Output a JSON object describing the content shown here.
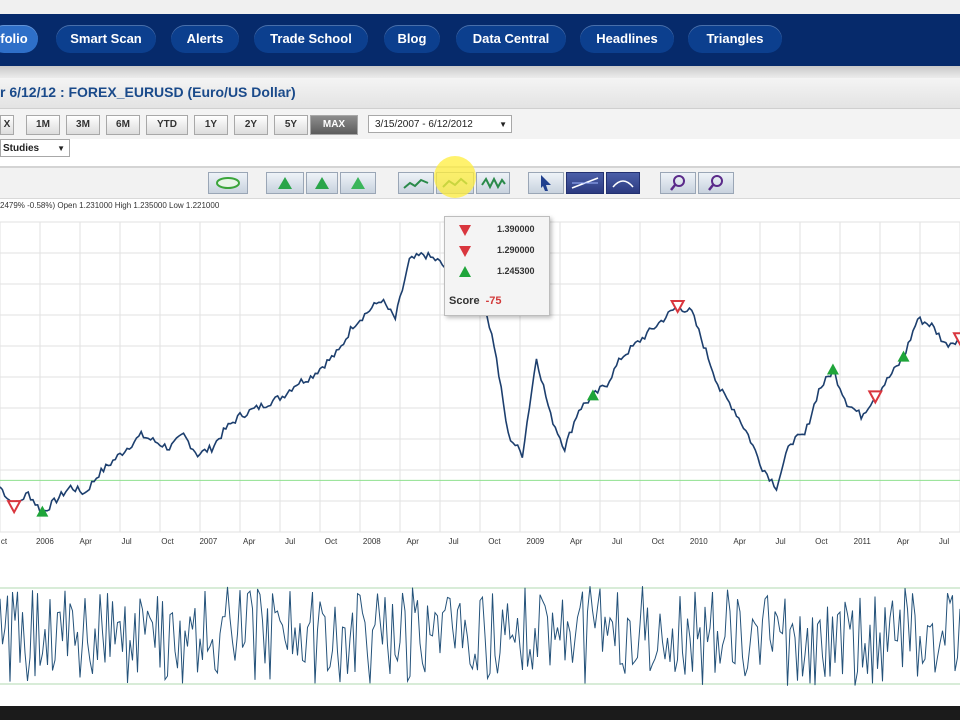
{
  "nav": {
    "items": [
      "folio",
      "Smart Scan",
      "Alerts",
      "Trade School",
      "Blog",
      "Data Central",
      "Headlines",
      "Triangles"
    ]
  },
  "title": "r 6/12/12 : FOREX_EURUSD (Euro/US Dollar)",
  "ranges": [
    "X",
    "1M",
    "3M",
    "6M",
    "YTD",
    "1Y",
    "2Y",
    "5Y",
    "MAX"
  ],
  "selected_range": "MAX",
  "date_range": "3/15/2007 - 6/12/2012",
  "studies_label": "Studies",
  "info_line": "2479% -0.58%) Open 1.231000 High 1.235000 Low 1.221000",
  "popup": {
    "rows": [
      {
        "marker": "sell",
        "value": "1.390000"
      },
      {
        "marker": "sell",
        "value": "1.290000"
      },
      {
        "marker": "buy",
        "value": "1.245300"
      }
    ],
    "score_label": "Score",
    "score_value": "-75"
  },
  "chart_data": {
    "type": "line",
    "x_ticks": [
      "ct",
      "2006",
      "Apr",
      "Jul",
      "Oct",
      "2007",
      "Apr",
      "Jul",
      "Oct",
      "2008",
      "Apr",
      "Jul",
      "Oct",
      "2009",
      "Apr",
      "Jul",
      "Oct",
      "2010",
      "Apr",
      "Jul",
      "Oct",
      "2011",
      "Apr",
      "Jul"
    ],
    "ylim": [
      1.15,
      1.63
    ],
    "reference_line": 1.23,
    "series": [
      {
        "values": [
          1.22,
          1.19,
          1.21,
          1.18,
          1.2,
          1.22,
          1.21,
          1.24,
          1.26,
          1.28,
          1.3,
          1.29,
          1.28,
          1.3,
          1.27,
          1.28,
          1.31,
          1.33,
          1.34,
          1.35,
          1.36,
          1.38,
          1.39,
          1.41,
          1.43,
          1.47,
          1.49,
          1.51,
          1.48,
          1.57,
          1.58,
          1.57,
          1.55,
          1.56,
          1.53,
          1.44,
          1.3,
          1.27,
          1.42,
          1.33,
          1.28,
          1.34,
          1.36,
          1.38,
          1.42,
          1.44,
          1.46,
          1.48,
          1.5,
          1.49,
          1.43,
          1.37,
          1.34,
          1.3,
          1.25,
          1.22,
          1.29,
          1.3,
          1.37,
          1.4,
          1.35,
          1.33,
          1.36,
          1.39,
          1.42,
          1.48,
          1.47,
          1.44,
          1.45
        ]
      }
    ],
    "signals": [
      {
        "type": "sell",
        "index": 1
      },
      {
        "type": "buy",
        "index": 3
      },
      {
        "type": "buy",
        "index": 42
      },
      {
        "type": "sell",
        "index": 48
      },
      {
        "type": "buy",
        "index": 59
      },
      {
        "type": "sell",
        "index": 62
      },
      {
        "type": "buy",
        "index": 64
      },
      {
        "type": "sell",
        "index": 68
      }
    ]
  },
  "colors": {
    "line": "#1d3f6e",
    "buy": "#1fa53a",
    "sell": "#d9363e",
    "nav_bg": "#062a6b",
    "reference": "#8fe08f"
  }
}
